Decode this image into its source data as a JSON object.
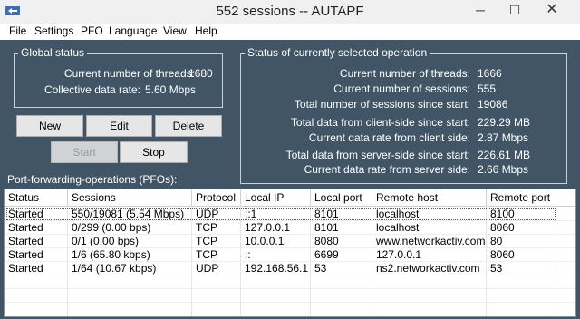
{
  "window": {
    "title": "552 sessions -- AUTAPF",
    "min_glyph": "─",
    "max_glyph": "☐",
    "close_glyph": "✕"
  },
  "menu": [
    "File",
    "Settings",
    "PFO",
    "Language",
    "View",
    "Help"
  ],
  "global_status": {
    "legend": "Global status",
    "threads_label": "Current number of threads:",
    "threads_value": "1680",
    "rate_label": "Collective data rate:",
    "rate_value": "5.60 Mbps"
  },
  "buttons": {
    "new": "New",
    "edit": "Edit",
    "delete": "Delete",
    "start": "Start",
    "stop": "Stop"
  },
  "operation_status": {
    "legend": "Status of currently selected operation",
    "lines": [
      {
        "label": "Current number of threads:",
        "value": "1666"
      },
      {
        "label": "Current number of sessions:",
        "value": "555"
      },
      {
        "label": "Total number of sessions since start:",
        "value": "19086"
      },
      {
        "label": "Total data from client-side since start:",
        "value": "229.29 MB"
      },
      {
        "label": "Current data rate from client side:",
        "value": "2.87 Mbps"
      },
      {
        "label": "Total data from server-side since start:",
        "value": "226.61 MB"
      },
      {
        "label": "Current data rate from server side:",
        "value": "2.66 Mbps"
      }
    ]
  },
  "pfo_label": "Port-forwarding-operations (PFOs):",
  "table": {
    "columns": [
      "Status",
      "Sessions",
      "Protocol",
      "Local IP",
      "Local port",
      "Remote host",
      "Remote port"
    ],
    "rows": [
      [
        "Started",
        "550/19081 (5.54 Mbps)",
        "UDP",
        "::1",
        "8101",
        "localhost",
        "8100"
      ],
      [
        "Started",
        "0/299 (0.00 bps)",
        "TCP",
        "127.0.0.1",
        "8101",
        "localhost",
        "8060"
      ],
      [
        "Started",
        "0/1 (0.00 bps)",
        "TCP",
        "10.0.0.1",
        "8080",
        "www.networkactiv.com",
        "80"
      ],
      [
        "Started",
        "1/6 (65.80 kbps)",
        "TCP",
        "::",
        "6699",
        "127.0.0.1",
        "8060"
      ],
      [
        "Started",
        "1/64 (10.67 kbps)",
        "UDP",
        "192.168.56.1",
        "53",
        "ns2.networkactiv.com",
        "53"
      ]
    ]
  }
}
